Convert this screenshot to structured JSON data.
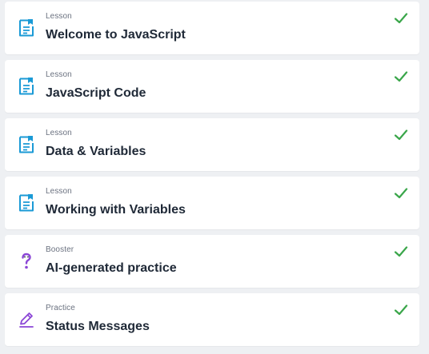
{
  "colors": {
    "lesson_icon": "#1a9ad6",
    "booster_icon": "#8b46d6",
    "practice_icon": "#8b46d6",
    "check": "#3aa64a",
    "background": "#eef0f3",
    "card": "#ffffff",
    "title_text": "#1f2937",
    "type_text": "#6b7280"
  },
  "items": [
    {
      "type": "Lesson",
      "title": "Welcome to JavaScript",
      "icon": "lesson-document-icon",
      "status_icon": "checkmark-icon"
    },
    {
      "type": "Lesson",
      "title": "JavaScript Code",
      "icon": "lesson-document-icon",
      "status_icon": "checkmark-icon"
    },
    {
      "type": "Lesson",
      "title": "Data & Variables",
      "icon": "lesson-document-icon",
      "status_icon": "checkmark-icon"
    },
    {
      "type": "Lesson",
      "title": "Working with Variables",
      "icon": "lesson-document-icon",
      "status_icon": "checkmark-icon"
    },
    {
      "type": "Booster",
      "title": "AI-generated practice",
      "icon": "question-mark-icon",
      "status_icon": "checkmark-icon"
    },
    {
      "type": "Practice",
      "title": "Status Messages",
      "icon": "pencil-icon",
      "status_icon": "checkmark-icon"
    }
  ]
}
